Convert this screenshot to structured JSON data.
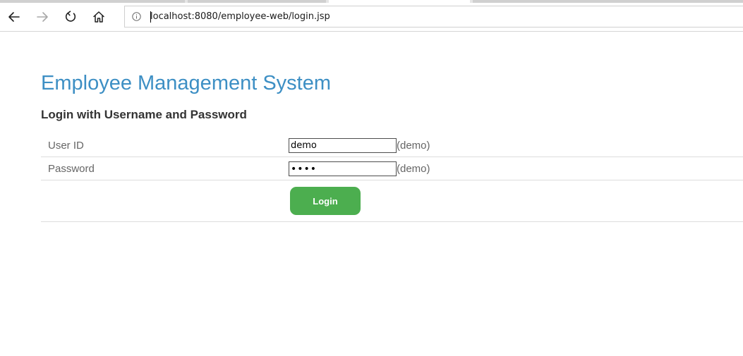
{
  "browser": {
    "url": "localhost:8080/employee-web/login.jsp",
    "icons": {
      "back": "back-arrow-icon",
      "forward": "forward-arrow-icon",
      "refresh": "refresh-icon",
      "home": "home-icon",
      "site_info": "info-icon"
    }
  },
  "page": {
    "title": "Employee Management System",
    "subtitle": "Login with Username and Password",
    "title_color": "#3d8fc4"
  },
  "form": {
    "user_id": {
      "label": "User ID",
      "value": "demo",
      "hint": "(demo)"
    },
    "password": {
      "label": "Password",
      "value": "demo",
      "hint": "(demo)"
    },
    "login_button": {
      "label": "Login",
      "color": "#4cae4f"
    }
  }
}
